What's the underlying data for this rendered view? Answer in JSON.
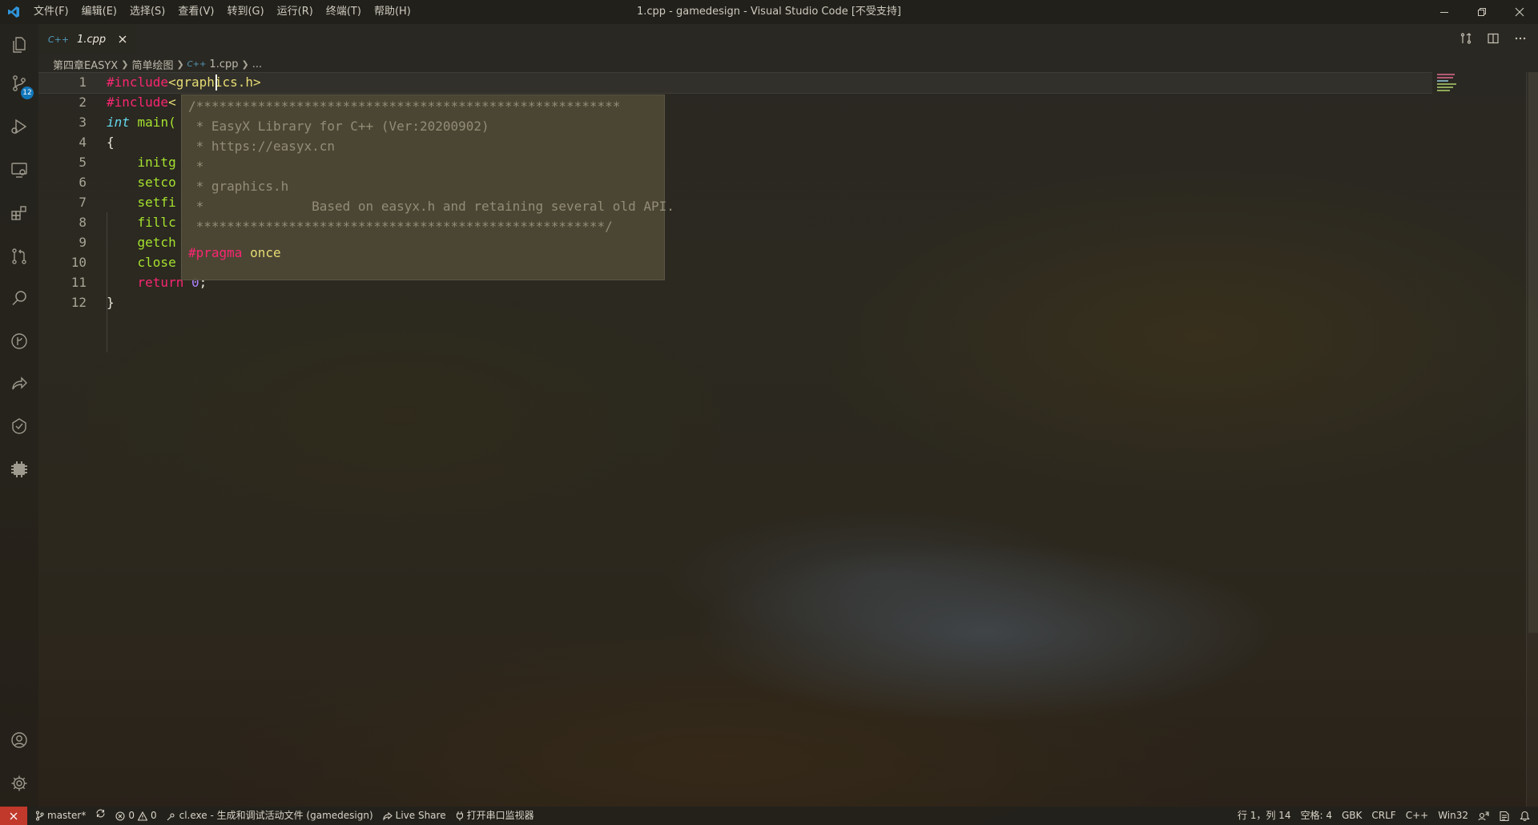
{
  "window": {
    "title": "1.cpp - gamedesign - Visual Studio Code [不受支持]",
    "menu": [
      "文件(F)",
      "编辑(E)",
      "选择(S)",
      "查看(V)",
      "转到(G)",
      "运行(R)",
      "终端(T)",
      "帮助(H)"
    ]
  },
  "activity_bar": {
    "items": [
      "explorer-icon",
      "source-control-icon",
      "run-debug-icon",
      "remote-explorer-icon",
      "extensions-icon",
      "pull-requests-icon",
      "search-icon",
      "git-graph-icon",
      "live-share-icon",
      "testing-icon",
      "platformio-icon"
    ],
    "scm_badge": "12",
    "bottom": [
      "accounts-icon",
      "settings-gear-icon"
    ]
  },
  "tab": {
    "icon": "C++",
    "label": "1.cpp"
  },
  "breadcrumb": {
    "folder1": "第四章EASYX",
    "folder2": "简单绘图",
    "file_icon": "C++",
    "file": "1.cpp",
    "symbol": "..."
  },
  "editor": {
    "line_numbers": [
      "1",
      "2",
      "3",
      "4",
      "5",
      "6",
      "7",
      "8",
      "9",
      "10",
      "11",
      "12"
    ],
    "lines": {
      "l1_pre": "#include",
      "l1_inc": "<graphics.h>",
      "l2_pre": "#include",
      "l2_inc": "<",
      "l3_type": "int",
      "l3_rest": " main(",
      "l4": "{",
      "l5": "    initg",
      "l6": "    setco",
      "l7": "    setfi",
      "l8": "    fillc",
      "l9": "    getch",
      "l10": "    close",
      "l11_kw": "    return",
      "l11_num": " 0",
      "l11_end": ";",
      "l12": "}"
    }
  },
  "hover": {
    "lines": [
      "/*******************************************************",
      " * EasyX Library for C++ (Ver:20200902)",
      " * https://easyx.cn",
      " *",
      " * graphics.h",
      " *\t\tBased on easyx.h and retaining several old API.",
      " *****************************************************/"
    ],
    "pragma_kw": "#pragma",
    "pragma_arg": "once"
  },
  "status_bar": {
    "branch": "master*",
    "errors": "0",
    "warnings": "0",
    "build_task": "cl.exe - 生成和调试活动文件 (gamedesign)",
    "live_share": "Live Share",
    "serial_monitor": "打开串口监视器",
    "cursor_pos": "行 1，列 14",
    "indent": "空格: 4",
    "encoding": "GBK",
    "eol": "CRLF",
    "language": "C++",
    "platform": "Win32"
  },
  "colors": {
    "accent_remote": "#c0392b",
    "badge": "#1177bb",
    "keyword": "#f92672",
    "string": "#e6db74",
    "number": "#ae81ff",
    "type": "#66d9ef"
  }
}
